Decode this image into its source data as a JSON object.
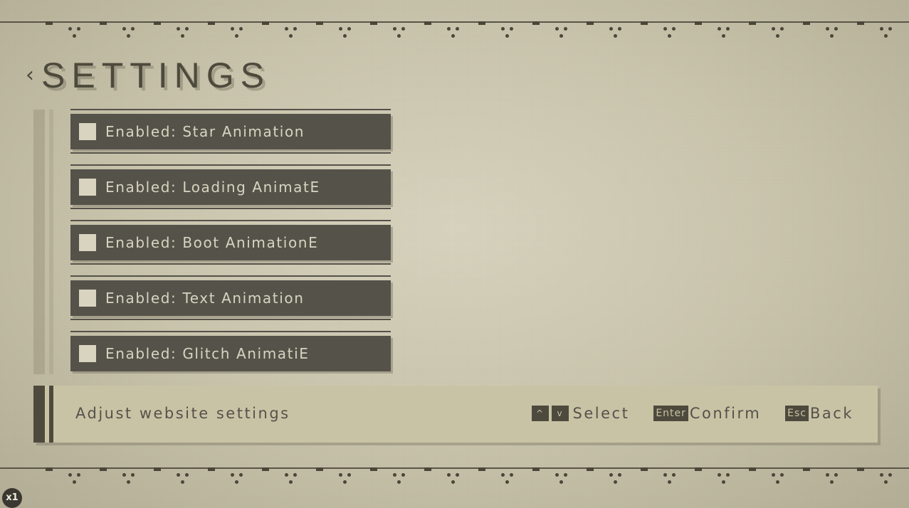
{
  "header": {
    "back_icon": "chevron-left-icon",
    "back_glyph": "‹",
    "title": "SETTINGS"
  },
  "settings": {
    "items": [
      {
        "label": "Enabled: Star Animation",
        "checked": false
      },
      {
        "label": "Enabled: Loading AnimatE",
        "checked": false
      },
      {
        "label": "Enabled: Boot AnimationE",
        "checked": false
      },
      {
        "label": "Enabled: Text Animation",
        "checked": false
      },
      {
        "label": "Enabled: Glitch AnimatiE",
        "checked": false
      }
    ]
  },
  "footer": {
    "description": "Adjust website settings",
    "hints": {
      "select": {
        "up_key": "^",
        "down_key": "v",
        "label": "Select"
      },
      "confirm": {
        "key": "Enter",
        "label": "Confirm"
      },
      "back": {
        "key": "Esc",
        "label": "Back"
      }
    }
  },
  "zoom": "x1",
  "colors": {
    "background": "#cdc8b2",
    "dark": "#4d4a3d",
    "item_bar": "#55524a",
    "item_text": "#d8d4c0",
    "footer_bg": "#c9c3a6"
  }
}
